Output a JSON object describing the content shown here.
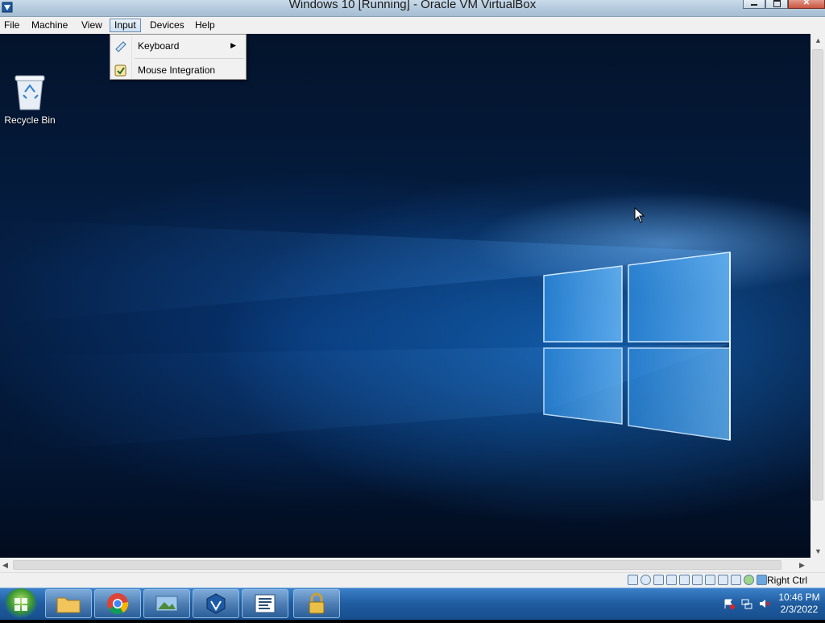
{
  "window": {
    "title": "Windows 10 [Running] - Oracle VM VirtualBox"
  },
  "menubar": {
    "items": [
      "File",
      "Machine",
      "View",
      "Input",
      "Devices",
      "Help"
    ],
    "active": "Input"
  },
  "input_menu": {
    "items": [
      {
        "label": "Keyboard",
        "has_submenu": true
      },
      {
        "label": "Mouse Integration",
        "has_submenu": false
      }
    ]
  },
  "desktop": {
    "icons": [
      {
        "label": "Recycle Bin"
      }
    ]
  },
  "statusbar": {
    "host_key": "Right Ctrl"
  },
  "taskbar": {
    "pinned": [
      "file-explorer",
      "chrome",
      "photos",
      "virtualbox",
      "notepad",
      "lock"
    ],
    "clock": {
      "time": "10:46 PM",
      "date": "2/3/2022"
    }
  },
  "colors": {
    "titlebar": "#b8cde0",
    "taskbar": "#1f5b9f",
    "desktop_bg": "#03132b",
    "menu_highlight": "#cfe1f3"
  }
}
